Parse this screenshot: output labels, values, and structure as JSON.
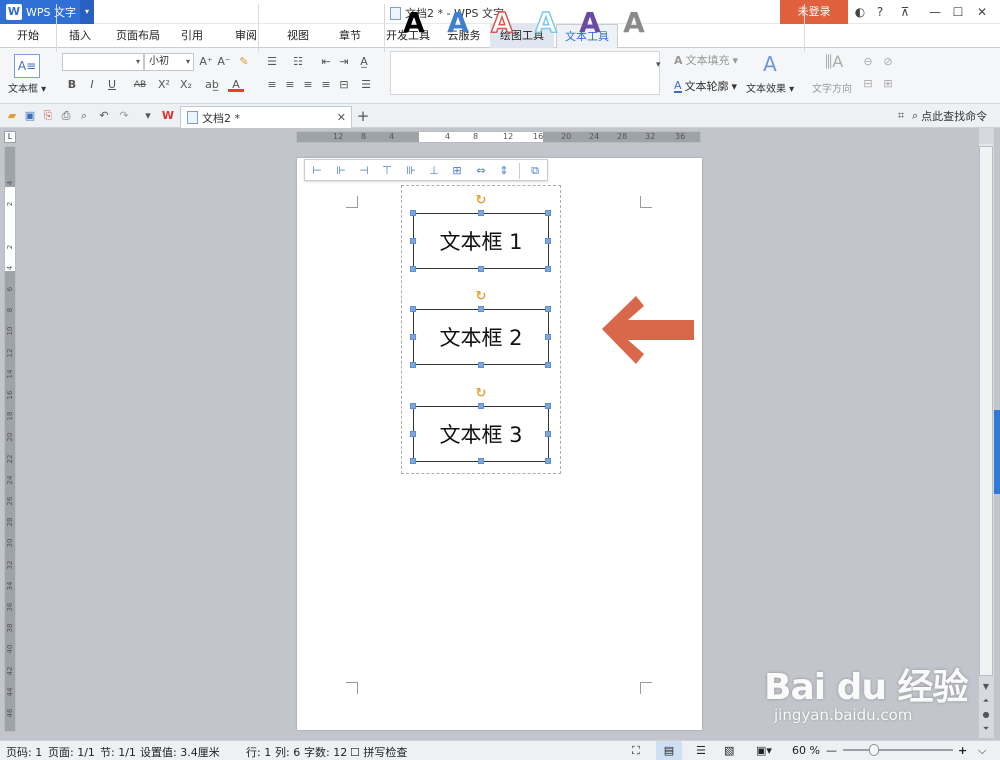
{
  "titlebar": {
    "app_name": "WPS 文字",
    "window_title": "文档2 * - WPS 文字",
    "login_label": "未登录"
  },
  "tabs": [
    {
      "label": "开始"
    },
    {
      "label": "插入"
    },
    {
      "label": "页面布局"
    },
    {
      "label": "引用"
    },
    {
      "label": "审阅"
    },
    {
      "label": "视图"
    },
    {
      "label": "章节"
    },
    {
      "label": "开发工具"
    },
    {
      "label": "云服务"
    },
    {
      "label": "绘图工具"
    },
    {
      "label": "文本工具"
    }
  ],
  "ribbon": {
    "textbox_label": "文本框",
    "font_name": "",
    "font_size": "小初",
    "text_fill_label": "文本填充",
    "text_outline_label": "文本轮廓",
    "text_effect_label": "文本效果",
    "text_direction_label": "文字方向",
    "style_colors": [
      "#000000",
      "#3f7fd2",
      "#e0574f",
      "#7fc9e8",
      "#6a4aa3",
      "#8a8a8a"
    ]
  },
  "quick_access": {
    "doc_tab": "文档2 *",
    "search_command": "点此查找命令"
  },
  "ruler": {
    "h_ticks": [
      "12",
      "8",
      "4",
      "",
      "4",
      "8",
      "12",
      "16",
      "20",
      "24",
      "28",
      "32",
      "36"
    ],
    "v_ticks": [
      "4",
      "2",
      "",
      "2",
      "4",
      "6",
      "8",
      "10",
      "12",
      "14",
      "16",
      "18",
      "20",
      "22",
      "24",
      "26",
      "28",
      "30",
      "32",
      "34",
      "36",
      "38",
      "40",
      "42",
      "44",
      "46"
    ]
  },
  "document": {
    "textboxes": [
      {
        "text": "文本框 1"
      },
      {
        "text": "文本框 2"
      },
      {
        "text": "文本框 3"
      }
    ],
    "arrow_color": "#d9674a"
  },
  "status": {
    "page": "页码: 1",
    "pages": "页面: 1/1",
    "section": "节: 1/1",
    "setting": "设置值: 3.4厘米",
    "row": "行: 1",
    "col": "列: 6",
    "words": "字数: 12",
    "spell": "拼写检查",
    "zoom": "60 %"
  },
  "watermark": {
    "line1": "Bai du 经验",
    "line2": "jingyan.baidu.com"
  }
}
